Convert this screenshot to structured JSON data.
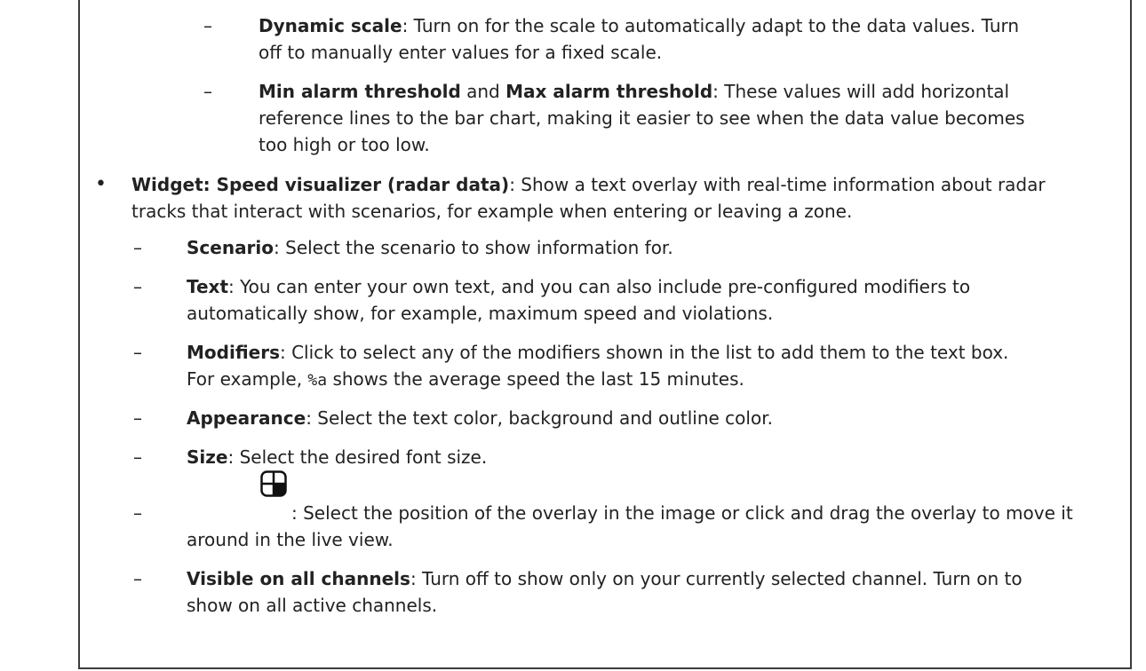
{
  "block1": {
    "dynamic_scale": {
      "bold": "Dynamic scale",
      "line1": ": Turn on for the scale to automatically adapt to the data values. Turn",
      "line2": "off to manually enter values for a fixed scale."
    },
    "thresholds": {
      "bold1": "Min alarm threshold",
      "and": " and ",
      "bold2": "Max alarm threshold",
      "line1": ": These values will add horizontal",
      "line2": "reference lines to the bar chart, making it easier to see when the data value becomes",
      "line3": "too high or too low."
    }
  },
  "speed_widget": {
    "bullet": "•",
    "bold": "Widget: Speed visualizer (radar data)",
    "line1": ": Show a text overlay with real-time information about radar",
    "line2": "tracks that interact with scenarios, for example when entering or leaving a zone.",
    "items": [
      {
        "bold": "Scenario",
        "lines": [
          ": Select the scenario to show information for."
        ]
      },
      {
        "bold": "Text",
        "lines": [
          ": You can enter your own text, and you can also include pre-configured modifiers to",
          "automatically show, for example, maximum speed and violations."
        ]
      },
      {
        "bold": "Modifiers",
        "lines": [
          ": Click to select any of the modifiers shown in the list to add them to the text box."
        ],
        "line2_pre": "For example, ",
        "line2_code": "%a",
        "line2_post": " shows the average speed the last 15 minutes."
      },
      {
        "bold": "Appearance",
        "lines": [
          ": Select the text color, background and outline color."
        ]
      },
      {
        "bold": "Size",
        "lines": [
          ": Select the desired font size."
        ]
      },
      {
        "icon": "position-grid-icon",
        "lines": [
          ": Select the position of the overlay in the image or click and drag the overlay to move it",
          "around in the live view."
        ]
      },
      {
        "bold": "Visible on all channels",
        "lines": [
          ": Turn off to show only on your currently selected channel. Turn on to",
          "show on all active channels."
        ]
      }
    ]
  },
  "dash_char": "–"
}
